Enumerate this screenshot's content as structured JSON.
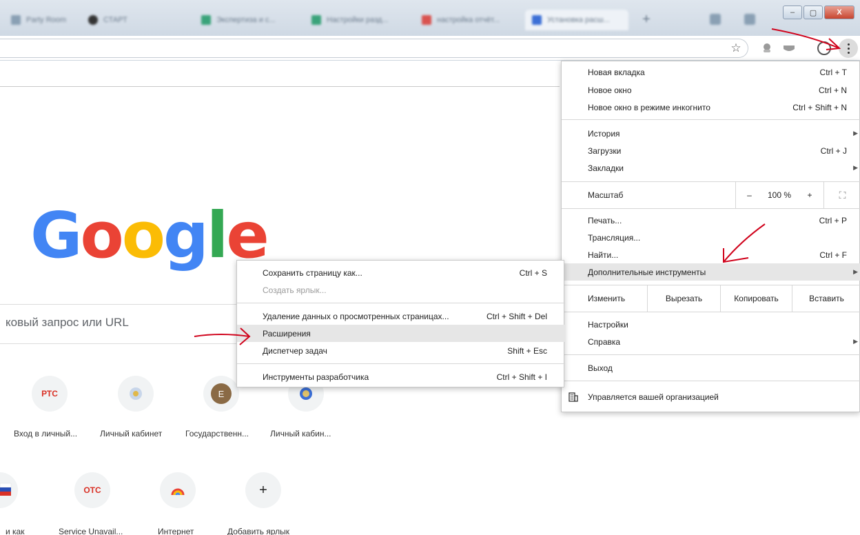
{
  "browser": {
    "tabs": [
      {
        "label": "Party Room",
        "color": "#8aa0b4"
      },
      {
        "label": "СТАРТ",
        "color": "#333333"
      },
      {
        "label": "Экспертиза и с...",
        "color": "#3aa37a"
      },
      {
        "label": "Настройки разд...",
        "color": "#3aa37a"
      },
      {
        "label": "настройка отчёт...",
        "color": "#d9534f"
      },
      {
        "label": "Установка расш...",
        "color": "#3b6fd6"
      }
    ],
    "new_tab": "+",
    "window_buttons": {
      "minimize": "–",
      "maximize": "▢",
      "close": "X"
    },
    "star": "☆"
  },
  "page": {
    "logo": [
      {
        "ch": "G",
        "color": "#4285F4"
      },
      {
        "ch": "o",
        "color": "#EA4335"
      },
      {
        "ch": "o",
        "color": "#FBBC05"
      },
      {
        "ch": "g",
        "color": "#4285F4"
      },
      {
        "ch": "l",
        "color": "#34A853"
      },
      {
        "ch": "e",
        "color": "#EA4335"
      }
    ],
    "search_placeholder": "ковый запрос или URL",
    "shortcuts_row1": [
      {
        "icon": "РТС",
        "icon_color": "#d93025",
        "label": "Вход в личный..."
      },
      {
        "icon": "",
        "icon_color": "#7a9cc6",
        "label": "Личный кабинет"
      },
      {
        "icon": "E",
        "icon_color": "#8a6a45",
        "label": "Государственн..."
      },
      {
        "icon": "",
        "icon_color": "#3b6fd6",
        "label": "Личный кабин..."
      }
    ],
    "shortcuts_row2": [
      {
        "icon": "",
        "icon_color": "#d93025",
        "label": "и как"
      },
      {
        "icon": "ОТС",
        "icon_color": "#d93025",
        "label": "Service Unavail..."
      },
      {
        "icon": "",
        "icon_color": "#e5a323",
        "label": "Интернет"
      },
      {
        "icon": "+",
        "icon_color": "#222222",
        "label": "Добавить ярлык"
      }
    ]
  },
  "menu": {
    "new_tab": {
      "label": "Новая вкладка",
      "shortcut": "Ctrl + T"
    },
    "new_window": {
      "label": "Новое окно",
      "shortcut": "Ctrl + N"
    },
    "incognito": {
      "label": "Новое окно в режиме инкогнито",
      "shortcut": "Ctrl + Shift + N"
    },
    "history": {
      "label": "История",
      "arrow": "▶"
    },
    "downloads": {
      "label": "Загрузки",
      "shortcut": "Ctrl + J"
    },
    "bookmarks": {
      "label": "Закладки",
      "arrow": "▶"
    },
    "zoom": {
      "label": "Масштаб",
      "minus": "–",
      "value": "100 %",
      "plus": "+",
      "fullscreen": "⛶"
    },
    "print": {
      "label": "Печать...",
      "shortcut": "Ctrl + P"
    },
    "cast": {
      "label": "Трансляция..."
    },
    "find": {
      "label": "Найти...",
      "shortcut": "Ctrl + F"
    },
    "more_tools": {
      "label": "Дополнительные инструменты",
      "arrow": "▶"
    },
    "edit": {
      "label": "Изменить",
      "cut": "Вырезать",
      "copy": "Копировать",
      "paste": "Вставить"
    },
    "settings": {
      "label": "Настройки"
    },
    "help": {
      "label": "Справка",
      "arrow": "▶"
    },
    "exit": {
      "label": "Выход"
    },
    "managed": {
      "label": "Управляется вашей организацией"
    }
  },
  "submenu": {
    "save_page": {
      "label": "Сохранить страницу как...",
      "shortcut": "Ctrl + S"
    },
    "create_shortcut": {
      "label": "Создать ярлык..."
    },
    "clear_data": {
      "label": "Удаление данных о просмотренных страницах...",
      "shortcut": "Ctrl + Shift + Del"
    },
    "extensions": {
      "label": "Расширения"
    },
    "task_manager": {
      "label": "Диспетчер задач",
      "shortcut": "Shift + Esc"
    },
    "dev_tools": {
      "label": "Инструменты разработчика",
      "shortcut": "Ctrl + Shift + I"
    }
  },
  "colors": {
    "annotation": "#d0021b",
    "highlight": "#e6e6e6"
  }
}
